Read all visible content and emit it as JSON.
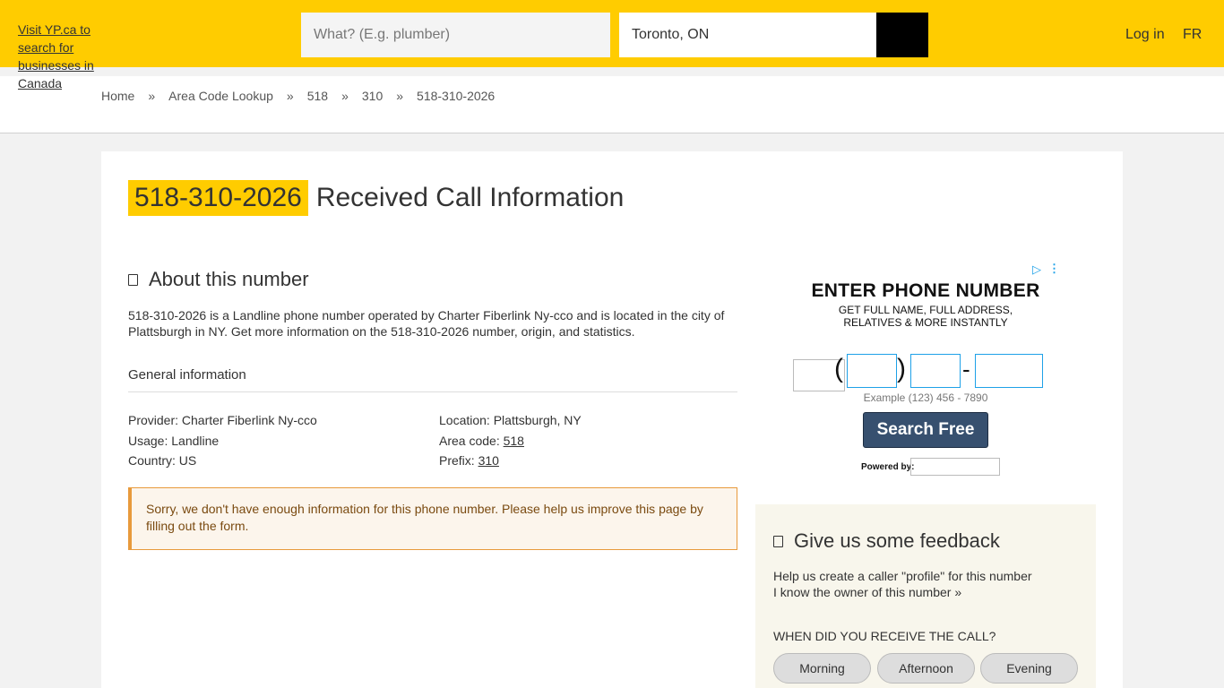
{
  "header": {
    "logo_alt": "Visit YP.ca to search for businesses in Canada",
    "what_placeholder": "What? (E.g. plumber)",
    "where_value": "Toronto, ON",
    "login_label": "Log in",
    "lang_label": "FR"
  },
  "breadcrumb": [
    "Home",
    "»",
    "Area Code Lookup",
    "»",
    "518",
    "»",
    "310",
    "»",
    "518-310-2026"
  ],
  "page": {
    "number": "518-310-2026",
    "title_rest": "Received Call Information"
  },
  "about": {
    "heading": "About this number",
    "text": "518-310-2026 is a Landline phone number operated by Charter Fiberlink Ny-cco and is located in the city of Plattsburgh in NY. Get more information on the 518-310-2026 number, origin, and statistics.",
    "general_heading": "General information",
    "provider": "Provider: Charter Fiberlink Ny-cco",
    "usage": "Usage: Landline",
    "country": "Country: US",
    "location": "Location: Plattsburgh, NY",
    "area_code_label": "Area code: ",
    "area_code": "518",
    "prefix_label": "Prefix: ",
    "prefix": "310"
  },
  "alert": {
    "text": "Sorry, we don't have enough information for this phone number. Please help us improve this page by filling out the form."
  },
  "ad": {
    "play_icon": "▷",
    "dots_icon": "⋮",
    "heading": "ENTER PHONE NUMBER",
    "sub": "GET FULL NAME, FULL ADDRESS, RELATIVES & MORE INSTANTLY",
    "paren_open": "(",
    "paren_close": ")",
    "dash": "-",
    "example": "Example (123) 456 - 7890",
    "button": "Search Free",
    "powered": "Powered by:"
  },
  "feedback": {
    "heading": "Give us some feedback",
    "line1": "Help us create a caller \"profile\" for this number",
    "line2": "I know the owner of this number »",
    "question": "WHEN DID YOU RECEIVE THE CALL?",
    "options": [
      "Morning",
      "Afternoon",
      "Evening"
    ]
  },
  "colors": {
    "brand_yellow": "#ffcc00",
    "alert_border": "#e89a3c",
    "ad_button": "#37506f"
  }
}
